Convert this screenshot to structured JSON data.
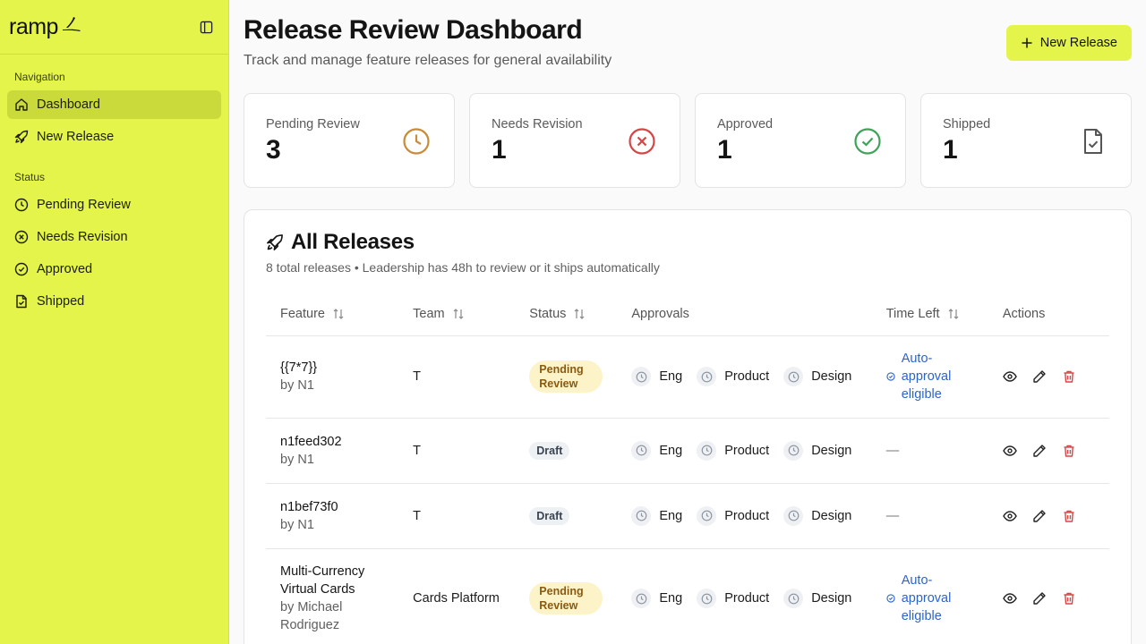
{
  "brand": {
    "logo_text": "ramp"
  },
  "sidebar": {
    "navigation_label": "Navigation",
    "nav_items": [
      {
        "label": "Dashboard",
        "icon": "home-icon"
      },
      {
        "label": "New Release",
        "icon": "rocket-icon"
      }
    ],
    "status_label": "Status",
    "status_items": [
      {
        "label": "Pending Review",
        "icon": "clock-icon"
      },
      {
        "label": "Needs Revision",
        "icon": "x-circle-icon"
      },
      {
        "label": "Approved",
        "icon": "check-circle-icon"
      },
      {
        "label": "Shipped",
        "icon": "file-check-icon"
      }
    ]
  },
  "header": {
    "title": "Release Review Dashboard",
    "subtitle": "Track and manage feature releases for general availability",
    "new_release_label": "New Release"
  },
  "stats": [
    {
      "label": "Pending Review",
      "value": "3",
      "icon": "clock-icon",
      "color": "#c98a3a"
    },
    {
      "label": "Needs Revision",
      "value": "1",
      "icon": "x-circle-icon",
      "color": "#d64545"
    },
    {
      "label": "Approved",
      "value": "1",
      "icon": "check-circle-icon",
      "color": "#3fa35a"
    },
    {
      "label": "Shipped",
      "value": "1",
      "icon": "file-check-icon",
      "color": "#555555"
    }
  ],
  "releases": {
    "title": "All Releases",
    "subtitle": "8 total releases • Leadership has 48h to review or it ships automatically",
    "columns": [
      "Feature",
      "Team",
      "Status",
      "Approvals",
      "Time Left",
      "Actions"
    ],
    "rows": [
      {
        "feature": "{{7*7}}",
        "by": "by N1",
        "team": "T",
        "status": "Pending Review",
        "approvals": [
          "Eng",
          "Product",
          "Design"
        ],
        "time_left": "Auto-approval eligible"
      },
      {
        "feature": "n1feed302",
        "by": "by N1",
        "team": "T",
        "status": "Draft",
        "approvals": [
          "Eng",
          "Product",
          "Design"
        ],
        "time_left": "—"
      },
      {
        "feature": "n1bef73f0",
        "by": "by N1",
        "team": "T",
        "status": "Draft",
        "approvals": [
          "Eng",
          "Product",
          "Design"
        ],
        "time_left": "—"
      },
      {
        "feature": "Multi-Currency Virtual Cards",
        "by": "by Michael Rodriguez",
        "team": "Cards Platform",
        "status": "Pending Review",
        "approvals": [
          "Eng",
          "Product",
          "Design"
        ],
        "time_left": "Auto-approval eligible"
      }
    ]
  },
  "colors": {
    "accent": "#e4f44a",
    "link": "#2f63c7",
    "delete": "#d64545"
  }
}
